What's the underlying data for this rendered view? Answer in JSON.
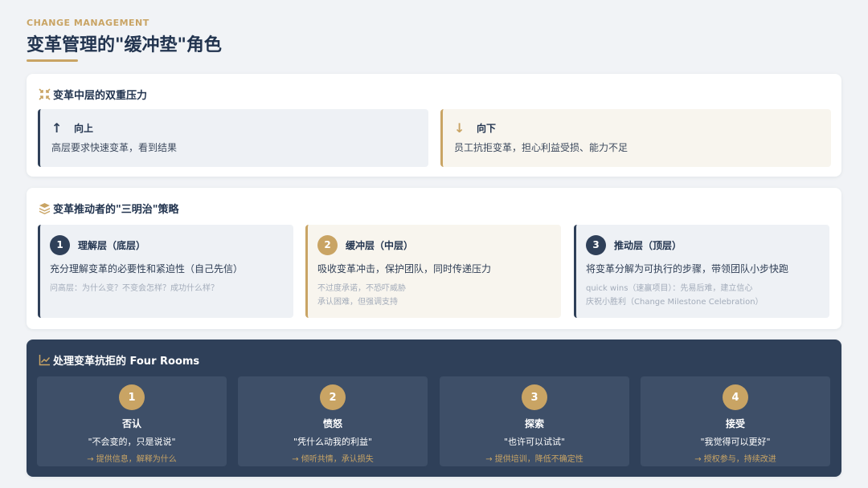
{
  "header": {
    "eyebrow": "CHANGE MANAGEMENT",
    "title": "变革管理的\"缓冲垫\"角色"
  },
  "pressure": {
    "title": "变革中层的双重压力",
    "icon": "compress-arrows-icon",
    "up": {
      "arrow": "↑",
      "label": "向上",
      "desc": "高层要求快速变革，看到结果"
    },
    "down": {
      "arrow": "↓",
      "label": "向下",
      "desc": "员工抗拒变革，担心利益受损、能力不足"
    }
  },
  "sandwich": {
    "title": "变革推动者的\"三明治\"策略",
    "icon": "layers-icon",
    "layers": [
      {
        "num": "1",
        "label": "理解层（底层）",
        "desc": "充分理解变革的必要性和紧迫性（自己先信）",
        "notes": [
          "问高层：为什么变？不变会怎样？成功什么样？"
        ]
      },
      {
        "num": "2",
        "label": "缓冲层（中层）",
        "desc": "吸收变革冲击，保护团队，同时传递压力",
        "notes": [
          "不过度承诺，不恐吓威胁",
          "承认困难，但强调支持"
        ]
      },
      {
        "num": "3",
        "label": "推动层（顶层）",
        "desc": "将变革分解为可执行的步骤，带领团队小步快跑",
        "notes": [
          "quick wins（速赢项目）：先易后难，建立信心",
          "庆祝小胜利（Change Milestone Celebration）"
        ]
      }
    ]
  },
  "rooms": {
    "title": "处理变革抗拒的 Four Rooms",
    "icon": "trend-chart-icon",
    "items": [
      {
        "num": "1",
        "name": "否认",
        "quote": "\"不会变的，只是说说\"",
        "action": "→ 提供信息，解释为什么"
      },
      {
        "num": "2",
        "name": "愤怒",
        "quote": "\"凭什么动我的利益\"",
        "action": "→ 倾听共情，承认损失"
      },
      {
        "num": "3",
        "name": "探索",
        "quote": "\"也许可以试试\"",
        "action": "→ 提供培训，降低不确定性"
      },
      {
        "num": "4",
        "name": "接受",
        "quote": "\"我觉得可以更好\"",
        "action": "→ 授权参与，持续改进"
      }
    ]
  },
  "colors": {
    "navy": "#2f4059",
    "gold": "#c9a464",
    "light": "#eef1f5",
    "cream": "#f8f5ee"
  }
}
